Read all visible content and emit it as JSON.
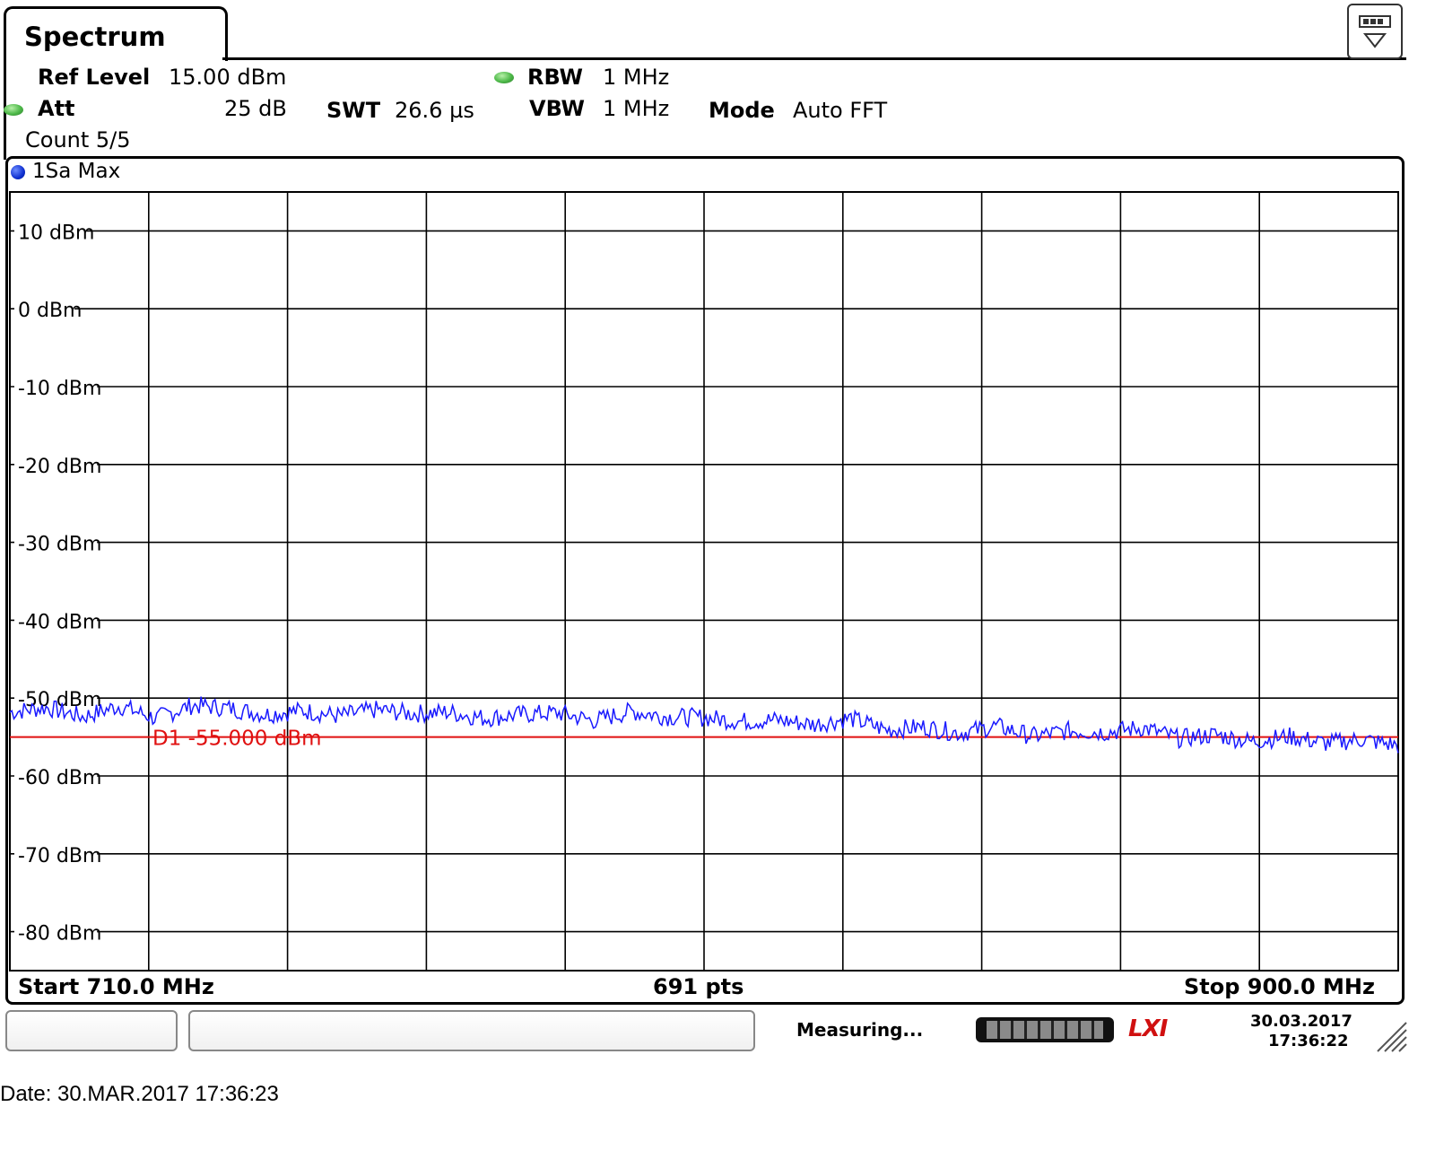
{
  "header": {
    "tab_title": "Spectrum",
    "ref_level_label": "Ref Level",
    "ref_level_value": "15.00 dBm",
    "att_label": "Att",
    "att_value": "25 dB",
    "swt_label": "SWT",
    "swt_value": "26.6 µs",
    "rbw_label": "RBW",
    "rbw_value": "1 MHz",
    "vbw_label": "VBW",
    "vbw_value": "1 MHz",
    "mode_label": "Mode",
    "mode_value": "Auto FFT",
    "count": "Count 5/5"
  },
  "trace": {
    "label": "1Sa Max",
    "color": "#1a1aff"
  },
  "chart_data": {
    "type": "line",
    "x_start_mhz": 710.0,
    "x_stop_mhz": 900.0,
    "ylim": [
      -90,
      15
    ],
    "yticks": [
      10,
      0,
      -10,
      -20,
      -30,
      -40,
      -50,
      -60,
      -70,
      -80
    ],
    "ytick_labels": [
      "10 dBm",
      "0 dBm",
      "-10 dBm",
      "-20 dBm",
      "-30 dBm",
      "-40 dBm",
      "-50 dBm",
      "-60 dBm",
      "-70 dBm",
      "-80 dBm"
    ],
    "grid": true,
    "x_divisions": 10,
    "series": [
      {
        "name": "1Sa Max",
        "x_mhz": [
          710,
          715,
          720,
          725,
          730,
          735,
          740,
          745,
          750,
          755,
          760,
          765,
          770,
          775,
          780,
          785,
          790,
          795,
          800,
          805,
          810,
          815,
          820,
          825,
          830,
          835,
          840,
          845,
          850,
          855,
          860,
          865,
          870,
          875,
          880,
          885,
          890,
          895,
          900
        ],
        "values_dbm": [
          -51.8,
          -51.2,
          -52.4,
          -51.0,
          -52.6,
          -50.9,
          -51.3,
          -52.1,
          -51.6,
          -52.3,
          -51.5,
          -52.0,
          -51.8,
          -52.6,
          -52.1,
          -51.9,
          -52.9,
          -51.7,
          -52.4,
          -52.5,
          -53.0,
          -52.8,
          -53.4,
          -52.6,
          -54.1,
          -53.7,
          -54.5,
          -53.6,
          -54.9,
          -54.2,
          -54.4,
          -53.8,
          -55.2,
          -54.7,
          -55.6,
          -54.9,
          -55.8,
          -55.3,
          -56.1
        ]
      }
    ],
    "display_line": {
      "label": "D1",
      "value_text": "-55.000 dBm",
      "value_dbm": -55.0,
      "color": "#e01010"
    }
  },
  "footer": {
    "start": "Start 710.0 MHz",
    "points": "691 pts",
    "stop": "Stop 900.0 MHz"
  },
  "status": {
    "text": "Measuring...",
    "date": "30.03.2017",
    "time": "17:36:22",
    "logo": "LXI"
  },
  "capture": {
    "date_line": "Date: 30.MAR.2017  17:36:23"
  }
}
